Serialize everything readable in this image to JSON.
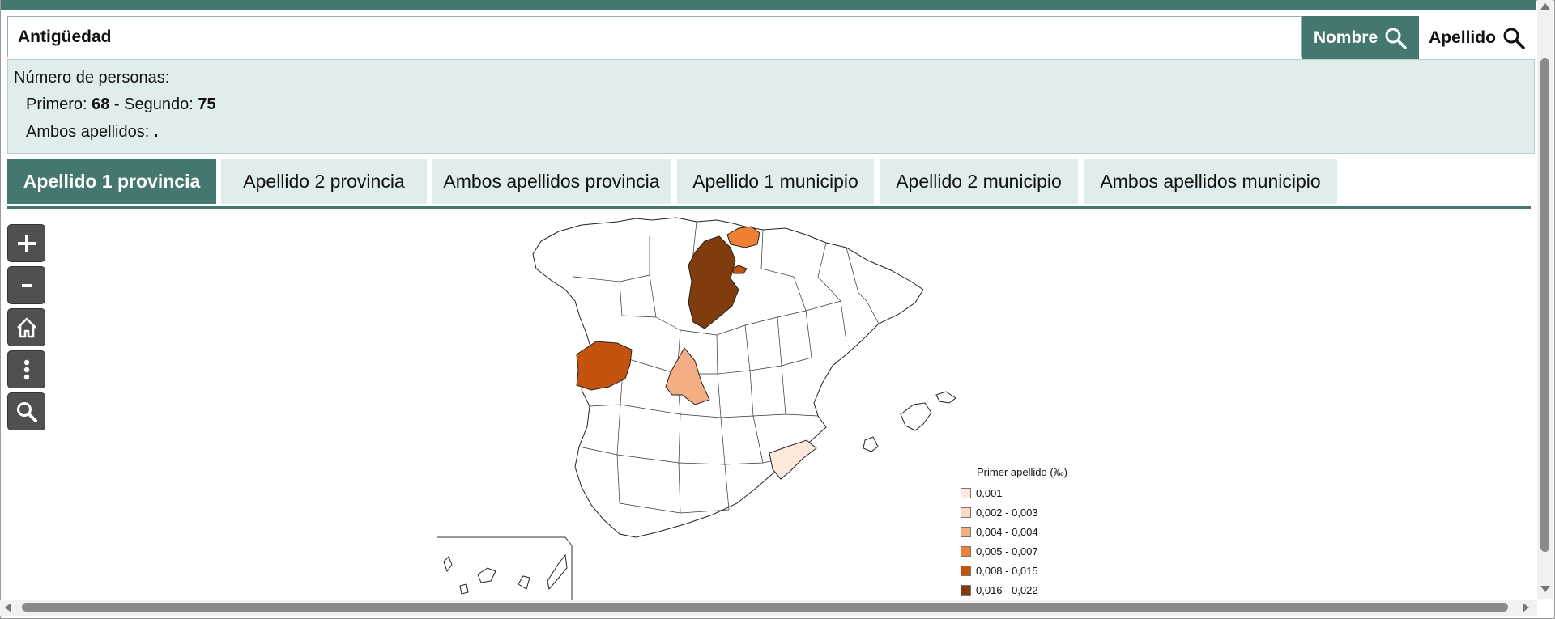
{
  "search": {
    "value": "Antigüedad",
    "nombre_label": "Nombre",
    "apellido_label": "Apellido",
    "icon": "search-icon"
  },
  "info": {
    "count_label": "Número de personas:",
    "primero_label": "Primero: ",
    "primero_value": "68",
    "segundo_label": " - Segundo: ",
    "segundo_value": "75",
    "ambos_label": "Ambos apellidos: ",
    "ambos_value": "."
  },
  "tabs": [
    {
      "label": "Apellido 1 provincia",
      "active": true
    },
    {
      "label": "Apellido 2 provincia",
      "active": false
    },
    {
      "label": "Ambos apellidos provincia",
      "active": false
    },
    {
      "label": "Apellido 1 municipio",
      "active": false
    },
    {
      "label": "Apellido 2 municipio",
      "active": false
    },
    {
      "label": "Ambos apellidos municipio",
      "active": false
    }
  ],
  "map_controls": [
    "zoom-in-icon",
    "zoom-out-icon",
    "home-icon",
    "more-vertical-icon",
    "search-icon"
  ],
  "legend": {
    "title": "Primer apellido (‰)",
    "items": [
      {
        "label": "0,001",
        "color": "#fde9dc"
      },
      {
        "label": "0,002 - 0,003",
        "color": "#fbd8c4"
      },
      {
        "label": "0,004 - 0,004",
        "color": "#f3ae83"
      },
      {
        "label": "0,005 - 0,007",
        "color": "#ee8033"
      },
      {
        "label": "0,008 - 0,015",
        "color": "#c4530e"
      },
      {
        "label": "0,016 - 0,022",
        "color": "#803c0c"
      }
    ]
  },
  "colors": {
    "accent": "#44776f",
    "panel": "#dfeeec"
  }
}
